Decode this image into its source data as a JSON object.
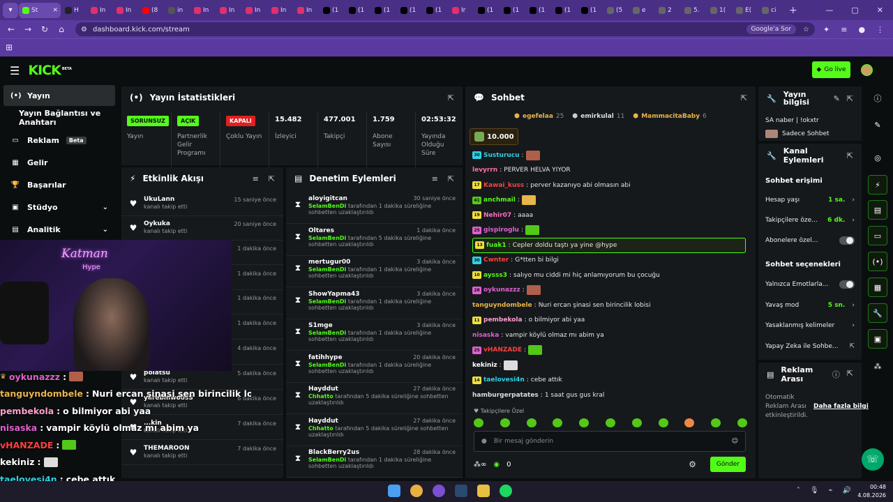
{
  "browser": {
    "active_tab_label": "St",
    "tabs": [
      "H",
      "In",
      "In",
      "(8",
      "in",
      "In",
      "In",
      "In",
      "In",
      "In",
      "(1",
      "(1",
      "(1",
      "(1",
      "(1",
      "Ir",
      "(1",
      "(1",
      "(1",
      "(1",
      "(1",
      "(5",
      "e",
      "2",
      "5.",
      "1(",
      "E(",
      "ci"
    ],
    "url": "dashboard.kick.com/stream",
    "google_pill": "Google'a Sor"
  },
  "topbar": {
    "logo": "KICK",
    "logo_sup": "BETA",
    "go_live": "Go live"
  },
  "sidebar": {
    "items": [
      {
        "label": "Yayın",
        "icon": "broadcast-icon",
        "active": true
      },
      {
        "label": "Yayın Bağlantısı ve Anahtarı",
        "icon": "",
        "active": false
      },
      {
        "label": "Reklam",
        "badge": "Beta",
        "icon": "ad-icon",
        "active": false
      },
      {
        "label": "Gelir",
        "icon": "chart-icon",
        "active": false
      },
      {
        "label": "Başarılar",
        "icon": "trophy-icon",
        "active": false
      },
      {
        "label": "Stüdyo",
        "icon": "studio-icon",
        "active": false
      },
      {
        "label": "Analitik",
        "icon": "analytics-icon",
        "active": false
      }
    ]
  },
  "stats": {
    "title": "Yayın İstatistikleri",
    "cells": [
      {
        "badge": "SORUNSUZ",
        "label": "Yayın"
      },
      {
        "badge": "AÇIK",
        "label": "Partnerlik Gelir Programı"
      },
      {
        "badge": "KAPALI",
        "label": "Çoklu Yayın"
      },
      {
        "value": "15.482",
        "label": "İzleyici"
      },
      {
        "value": "477.001",
        "label": "Takipçi"
      },
      {
        "value": "1.759",
        "label": "Abone Sayısı"
      },
      {
        "value": "02:53:32",
        "label": "Yayında Olduğu Süre"
      }
    ]
  },
  "activity": {
    "title": "Etkinlik Akışı",
    "rows": [
      {
        "name": "UkuLann",
        "sub": "kanalı takip etti",
        "time": "15 saniye önce"
      },
      {
        "name": "Oykuka",
        "sub": "kanalı takip etti",
        "time": "20 saniye önce"
      },
      {
        "name": "",
        "sub": "",
        "time": "1 dakika önce"
      },
      {
        "name": "",
        "sub": "",
        "time": "1 dakika önce"
      },
      {
        "name": "",
        "sub": "",
        "time": "1 dakika önce"
      },
      {
        "name": "",
        "sub": "",
        "time": "1 dakika önce"
      },
      {
        "name": "",
        "sub": "",
        "time": "4 dakika önce"
      },
      {
        "name": "polatsu",
        "sub": "kanalı takip etti",
        "time": "5 dakika önce"
      },
      {
        "name": "yarebmwoosS",
        "sub": "kanalı takip etti",
        "time": "6 dakika önce"
      },
      {
        "name": "...kin",
        "sub": "kanalı takip etti",
        "time": "7 dakika önce"
      },
      {
        "name": "THEMAROON",
        "sub": "kanalı takip etti",
        "time": "7 dakika önce"
      }
    ]
  },
  "moderation": {
    "title": "Denetim Eylemleri",
    "rows": [
      {
        "name": "aloyigitcan",
        "mod": "SelamBenDi",
        "text": "tarafından 1 dakika süreliğine sohbetten uzaklaştırıldı",
        "time": "30 saniye önce"
      },
      {
        "name": "Oltares",
        "mod": "SelamBenDi",
        "text": "tarafından 5 dakika süreliğine sohbetten uzaklaştırıldı",
        "time": "1 dakika önce"
      },
      {
        "name": "mertugur00",
        "mod": "SelamBenDi",
        "text": "tarafından 1 dakika süreliğine sohbetten uzaklaştırıldı",
        "time": "3 dakika önce"
      },
      {
        "name": "ShowYapma43",
        "mod": "SelamBenDi",
        "text": "tarafından 1 dakika süreliğine sohbetten uzaklaştırıldı",
        "time": "3 dakika önce"
      },
      {
        "name": "S1mge",
        "mod": "SelamBenDi",
        "text": "tarafından 1 dakika süreliğine sohbetten uzaklaştırıldı",
        "time": "3 dakika önce"
      },
      {
        "name": "fatihhype",
        "mod": "SelamBenDi",
        "text": "tarafından 1 dakika süreliğine sohbetten uzaklaştırıldı",
        "time": "20 dakika önce"
      },
      {
        "name": "Hayddut",
        "mod": "Chhatto",
        "text": "tarafından 5 dakika süreliğine sohbetten uzaklaştırıldı",
        "time": "27 dakika önce"
      },
      {
        "name": "Hayddut",
        "mod": "Chhatto",
        "text": "tarafından 5 dakika süreliğine sohbetten uzaklaştırıldı",
        "time": "27 dakika önce"
      },
      {
        "name": "BlackBerry2us",
        "mod": "SelamBenDi",
        "text": "tarafından 1 dakika süreliğine sohbetten uzaklaştırıldı",
        "time": "28 dakika önce"
      }
    ]
  },
  "chat": {
    "title": "Sohbet",
    "top_gifters": [
      {
        "name": "egefelaa",
        "count": "25"
      },
      {
        "name": "emirkulal",
        "count": "11"
      },
      {
        "name": "MammacitaBaby",
        "count": "6"
      }
    ],
    "gift_amount": "10.000",
    "messages": [
      {
        "lvl": "30",
        "lc": "#2ed2e6",
        "user": "Susturucu",
        "uc": "#2ed2e6",
        "text": "",
        "emote": "#b0604a"
      },
      {
        "lvl": "",
        "lc": "",
        "user": "levyrrn",
        "uc": "#ff6fa0",
        "text": "PERVER HELVA YIYOR",
        "emote": ""
      },
      {
        "lvl": "17",
        "lc": "#f0e040",
        "user": "Kawai_kuss",
        "uc": "#ff4040",
        "text": "perver kazanıyo abi olmasın abi",
        "emote": ""
      },
      {
        "lvl": "41",
        "lc": "#53c818",
        "user": "anchmail",
        "uc": "#53fc18",
        "text": "",
        "emote": "#e8b54a"
      },
      {
        "lvl": "19",
        "lc": "#f0e040",
        "user": "Nehir07",
        "uc": "#ff70c0",
        "text": "aaaa",
        "emote": ""
      },
      {
        "lvl": "25",
        "lc": "#e060d0",
        "user": "gispiroglu",
        "uc": "#e060d0",
        "text": "",
        "emote": "#53c818"
      },
      {
        "lvl": "13",
        "lc": "#f0e040",
        "user": "fuak1",
        "uc": "#53fc18",
        "text": "Cepler doldu taştı ya yine @hype",
        "emote": "",
        "hl": true
      },
      {
        "lvl": "30",
        "lc": "#2ed2e6",
        "user": "Cwnter",
        "uc": "#ff4040",
        "text": "G*tten bi bilgi",
        "emote": ""
      },
      {
        "lvl": "10",
        "lc": "#f0e040",
        "user": "aysss3",
        "uc": "#53fc18",
        "text": "salıyo mu ciddi mi hiç anlamıyorum bu çocuğu",
        "emote": ""
      },
      {
        "lvl": "28",
        "lc": "#e060d0",
        "user": "oykunazzz",
        "uc": "#e060d0",
        "text": "",
        "emote": "#b0604a"
      },
      {
        "lvl": "",
        "lc": "",
        "user": "tanguyndombele",
        "uc": "#e8b54a",
        "text": "Nuri ercan şinasi sen birincilik lobisi",
        "emote": ""
      },
      {
        "lvl": "11",
        "lc": "#f0e040",
        "user": "pembekola",
        "uc": "#ff9ed0",
        "text": "o bilmiyor abi yaa",
        "emote": ""
      },
      {
        "lvl": "",
        "lc": "",
        "user": "nisaska",
        "uc": "#e060d0",
        "text": "vampir köylü olmaz mı abim ya",
        "emote": ""
      },
      {
        "lvl": "25",
        "lc": "#e060d0",
        "user": "vHANZADE",
        "uc": "#ff4040",
        "text": "",
        "emote": "#53c818"
      },
      {
        "lvl": "",
        "lc": "",
        "user": "kekiniz",
        "uc": "#ffffff",
        "text": "",
        "emote": "#dddddd"
      },
      {
        "lvl": "14",
        "lc": "#f0e040",
        "user": "taelovesi4n",
        "uc": "#2ed2e6",
        "text": "cebe attık",
        "emote": ""
      },
      {
        "lvl": "",
        "lc": "",
        "user": "hamburgerpatates",
        "uc": "#dddddd",
        "text": "1 saat gus gus kral",
        "emote": ""
      }
    ],
    "followers_only_label": "Takipçilere Özel",
    "input_placeholder": "Bir mesaj gönderin",
    "kicks_count": "0",
    "send_label": "Gönder"
  },
  "stream_info": {
    "title": "Yayın bilgisi",
    "stream_title": "SA naber | !okxtr",
    "category": "Sadece Sohbet"
  },
  "channel_actions": {
    "title": "Kanal Eylemleri",
    "chat_access_heading": "Sohbet erişimi",
    "access_rows": [
      {
        "label": "Hesap yaşı",
        "value": "1 sa."
      },
      {
        "label": "Takipçilere öze...",
        "value": "6 dk."
      },
      {
        "label": "Abonelere özel...",
        "value": ""
      }
    ],
    "chat_options_heading": "Sohbet seçenekleri",
    "option_rows": [
      {
        "label": "Yalnızca Emotlarla...",
        "value": ""
      },
      {
        "label": "Yavaş mod",
        "value": "5 sn."
      },
      {
        "label": "Yasaklanmış kelimeler",
        "value": ""
      },
      {
        "label": "Yapay Zeka ile Sohbe...",
        "value": ""
      }
    ]
  },
  "ad_break": {
    "title": "Reklam Arası",
    "desc": "Otomatik Reklam Arası etkinleştirildi.",
    "more_link": "Daha fazla bilgi"
  },
  "overlay_chat": [
    {
      "user": "oykunazzz",
      "uc": "#e060d0",
      "text": ""
    },
    {
      "user": "tanguyndombele",
      "uc": "#e8b54a",
      "text": "Nuri ercan şinasi sen birincilik lobisi"
    },
    {
      "user": "pembekola",
      "uc": "#ff9ed0",
      "text": "o bilmiyor abi yaa"
    },
    {
      "user": "nisaska",
      "uc": "#e060d0",
      "text": "vampir köylü olmaz mı abim ya"
    },
    {
      "user": "vHANZADE",
      "uc": "#ff4040",
      "text": ""
    },
    {
      "user": "kekiniz",
      "uc": "#ffffff",
      "text": ""
    },
    {
      "user": "taelovesi4n",
      "uc": "#2ed2e6",
      "text": "cebe attık"
    },
    {
      "user": "hamburgerpatates",
      "uc": "#ffffff",
      "text": "1 saat gus gus kral"
    }
  ],
  "cam": {
    "neon_text": "Katman",
    "neon_sub": "Hype"
  },
  "taskbar": {
    "time": "00:48",
    "date": "4.08.2026"
  },
  "colors": {
    "accent": "#53fc18",
    "panel": "#16191c",
    "browser": "#5b3aa0"
  }
}
